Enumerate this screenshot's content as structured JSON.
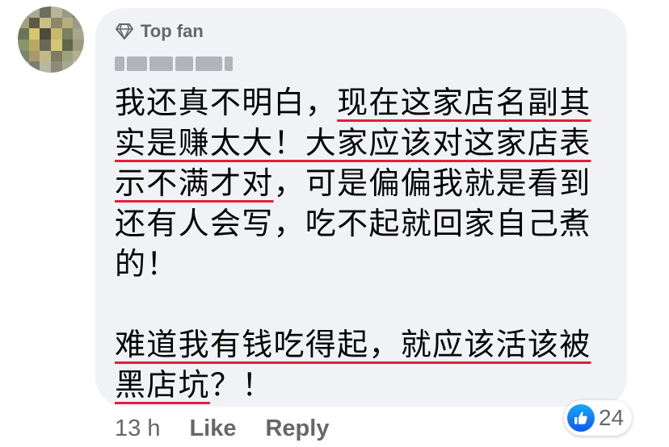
{
  "comment": {
    "badge": {
      "icon": "diamond-icon",
      "label": "Top fan"
    },
    "body": {
      "p1": [
        {
          "plain": "我还真不明白，",
          "underlined": "现在这家店名副其"
        },
        {
          "plain": "",
          "underlined": "实是赚太大！大家应该对这家店表"
        },
        {
          "underlined": "示不满才对",
          "plain": "，可是偏偏我就是看到"
        },
        {
          "plain": "还有人会写，吃不起就回家自己煮"
        },
        {
          "plain": "的！"
        }
      ],
      "p2": [
        {
          "underlined": "难道我有钱吃得起，就应该活该被"
        },
        {
          "underlined": "黑店坑",
          "plain": "？！"
        }
      ]
    },
    "underline_color": "#e41e3f",
    "bubble_color": "#f0f2f5"
  },
  "actions": {
    "time": "13 h",
    "like": "Like",
    "reply": "Reply"
  },
  "reactions": {
    "icon": "thumbs-up-icon",
    "count": "24",
    "color": "#1877f2"
  }
}
